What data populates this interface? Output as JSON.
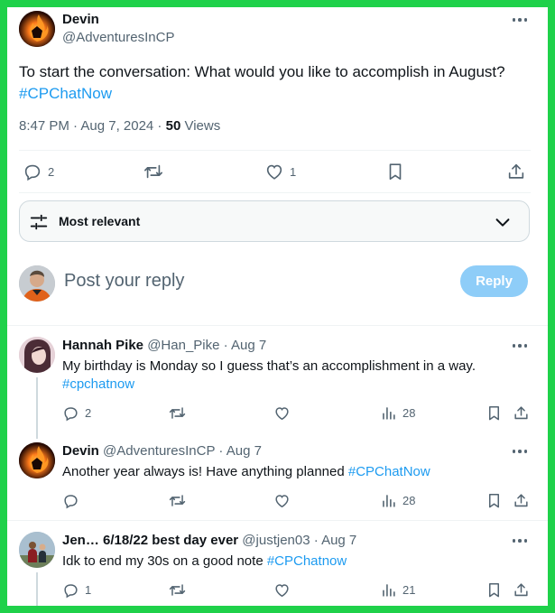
{
  "main_post": {
    "author_name": "Devin",
    "author_handle": "@AdventuresInCP",
    "text": "To start the conversation: What would you like to accomplish in August?",
    "hashtag": "#CPChatNow",
    "time_date": "8:47 PM · Aug 7, 2024 · ",
    "views_count": "50",
    "views_label": " Views",
    "replies": "2",
    "likes": "1"
  },
  "sort": {
    "label": "Most relevant"
  },
  "composer": {
    "placeholder": "Post your reply",
    "reply_label": "Reply"
  },
  "replies": [
    {
      "name": "Hannah Pike",
      "meta": "@Han_Pike · Aug 7",
      "text": "My birthday is Monday so I guess that’s an accomplishment in a way.",
      "hashtag": "#cpchatnow",
      "replies": "2",
      "views": "28"
    },
    {
      "name": "Devin",
      "meta": "@AdventuresInCP · Aug 7",
      "text": "Another year always is! Have anything planned ",
      "hashtag": "#CPChatNow",
      "replies": "",
      "views": "28"
    },
    {
      "name": "Jen… 6/18/22 best day ever",
      "meta": "@justjen03 · Aug 7",
      "text": "Idk to end my 30s on a good note ",
      "hashtag": "#CPChatnow",
      "replies": "1",
      "views": "21"
    }
  ],
  "colors": {
    "frame": "#1fd14a",
    "accent": "#1d9bf0",
    "reply_button": "#8ecdf8",
    "muted_text": "#536471"
  }
}
